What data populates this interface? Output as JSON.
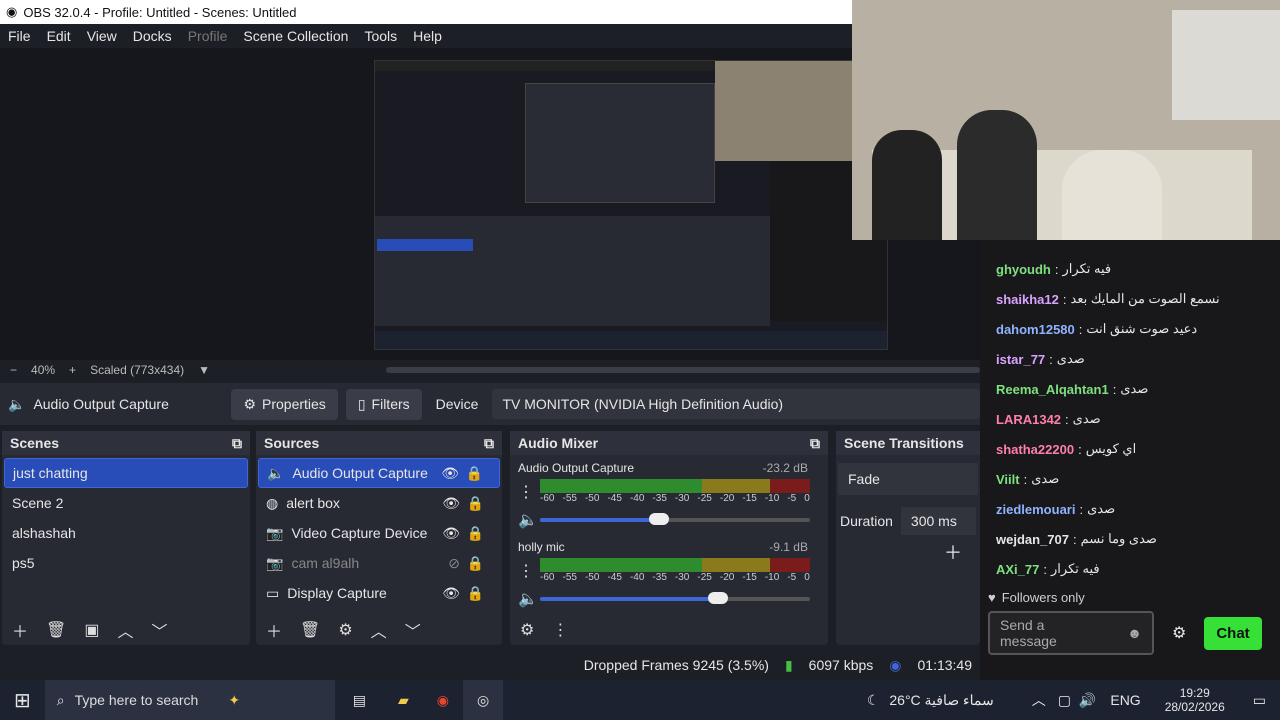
{
  "window": {
    "title": "OBS 32.0.4 - Profile: Untitled - Scenes: Untitled"
  },
  "menu": [
    "File",
    "Edit",
    "View",
    "Docks",
    "Profile",
    "Scene Collection",
    "Tools",
    "Help"
  ],
  "zoom": {
    "minus": "−",
    "percent": "40%",
    "plus": "+",
    "scaled": "Scaled (773x434)"
  },
  "props": {
    "source": "Audio Output Capture",
    "properties": "Properties",
    "filters": "Filters",
    "device_label": "Device",
    "device_value": "TV MONITOR (NVIDIA High Definition Audio)"
  },
  "scenes": {
    "title": "Scenes",
    "items": [
      "just chatting",
      "Scene 2",
      "alshashah",
      "ps5"
    ]
  },
  "sources": {
    "title": "Sources",
    "items": [
      "Audio Output Capture",
      "alert box",
      "Video Capture Device",
      "cam al9alh",
      "Display Capture"
    ]
  },
  "mixer": {
    "title": "Audio Mixer",
    "channels": [
      {
        "name": "Audio Output Capture",
        "db": "-23.2 dB",
        "volume": 0.44
      },
      {
        "name": "holly mic",
        "db": "-9.1 dB",
        "volume": 0.66
      }
    ],
    "scale": [
      "-60",
      "-55",
      "-50",
      "-45",
      "-40",
      "-35",
      "-30",
      "-25",
      "-20",
      "-15",
      "-10",
      "-5",
      "0"
    ]
  },
  "transitions": {
    "title": "Scene Transitions",
    "type": "Fade",
    "duration_label": "Duration",
    "duration": "300 ms"
  },
  "status": {
    "dropped": "Dropped Frames 9245 (3.5%)",
    "kbps": "6097 kbps",
    "time": "01:13:49"
  },
  "taskbar": {
    "search_placeholder": "Type here to search",
    "weather": "26°C  سماء صافية",
    "lang": "ENG",
    "clock_time": "19:29",
    "clock_date": "28/02/2026"
  },
  "chat": {
    "lines": [
      {
        "user": "ghyoudh",
        "color": "#7fe07f",
        "msg": "فيه تكرار"
      },
      {
        "user": "shaikha12",
        "color": "#d9a3ff",
        "msg": "نسمع الصوت من المايك بعد"
      },
      {
        "user": "dahom12580",
        "color": "#8fb3ff",
        "msg": "دعيد صوت شنق انت"
      },
      {
        "user": "istar_77",
        "color": "#d9a3ff",
        "msg": "صدى"
      },
      {
        "user": "Reema_Alqahtan1",
        "color": "#7fe07f",
        "msg": "صدى"
      },
      {
        "user": "LARA1342",
        "color": "#ff7fa8",
        "msg": "صدى"
      },
      {
        "user": "shatha22200",
        "color": "#ff7fa8",
        "msg": "اي كويس"
      },
      {
        "user": "Viilt",
        "color": "#7fe07f",
        "msg": "صدى"
      },
      {
        "user": "ziedlemouari",
        "color": "#8fb3ff",
        "msg": "صدى"
      },
      {
        "user": "wejdan_707",
        "color": "#e6e6e6",
        "msg": "صدى وما نسم"
      },
      {
        "user": "AXi_77",
        "color": "#7fe07f",
        "msg": "فيه تكرار"
      }
    ],
    "followers_only": "Followers only",
    "placeholder": "Send a message",
    "chat_button": "Chat"
  }
}
